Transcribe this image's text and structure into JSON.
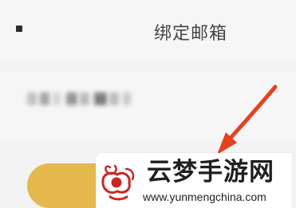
{
  "header": {
    "title": "绑定邮箱"
  },
  "email": {
    "masked_value": ""
  },
  "watermark": {
    "brand_text": "云梦手游网",
    "url_text": "www.yunmengchina.com"
  },
  "colors": {
    "accent_button": "#e4b84d",
    "arrow": "#e6411f",
    "watermark_red": "#c62828"
  },
  "icons": {
    "back": "back-icon",
    "arrow": "arrow-icon",
    "logo": "yunmeng-logo-icon"
  }
}
